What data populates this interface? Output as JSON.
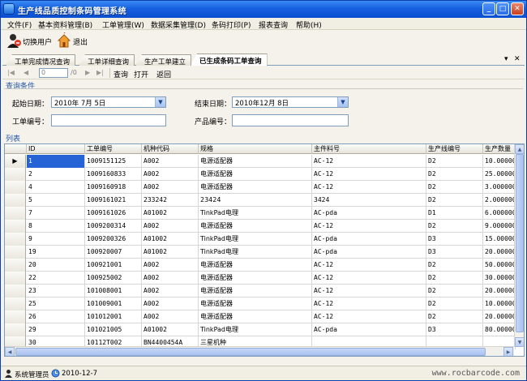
{
  "window": {
    "title": "生产线品质控制条码管理系统"
  },
  "menu": [
    "文件(F)",
    "基本资料管理(B)",
    "工单管理(W)",
    "数据采集管理(D)",
    "条码打印(P)",
    "报表查询",
    "帮助(H)"
  ],
  "toolbar": {
    "switch_user": "切换用户",
    "exit": "退出"
  },
  "tabs": [
    {
      "label": "工单完成情况查询",
      "active": false
    },
    {
      "label": "工单详细查询",
      "active": false
    },
    {
      "label": "生产工单建立",
      "active": false
    },
    {
      "label": "已生成条码工单查询",
      "active": true
    }
  ],
  "nav": {
    "page_value": "0",
    "page_total": "/0",
    "query": "查询",
    "open": "打开",
    "back": "返回"
  },
  "query": {
    "section_title": "查询条件",
    "start_date_label": "起始日期：",
    "start_date_value": "2010年 7月 5日",
    "end_date_label": "结束日期：",
    "end_date_value": "2010年12月 8日",
    "order_no_label": "工单编号：",
    "product_no_label": "产品编号："
  },
  "list": {
    "section_title": "列表",
    "columns": [
      "ID",
      "工单编号",
      "机种代码",
      "规格",
      "主件料号",
      "生产线编号",
      "生产数量"
    ],
    "rows": [
      [
        "1",
        "1009151125",
        "A002",
        "电源适配器",
        "AC-12",
        "D2",
        "10.000000"
      ],
      [
        "2",
        "1009160833",
        "A002",
        "电源适配器",
        "AC-12",
        "D2",
        "25.000000"
      ],
      [
        "4",
        "1009160918",
        "A002",
        "电源适配器",
        "AC-12",
        "D2",
        "3.0000000"
      ],
      [
        "5",
        "1009161021",
        "233242",
        "23424",
        "3424",
        "D2",
        "2.0000000"
      ],
      [
        "7",
        "1009161026",
        "A01002",
        "TinkPad电理",
        "AC-pda",
        "D1",
        "6.0000000"
      ],
      [
        "8",
        "1009200314",
        "A002",
        "电源适配器",
        "AC-12",
        "D2",
        "9.0000000"
      ],
      [
        "9",
        "1009200326",
        "A01002",
        "TinkPad电理",
        "AC-pda",
        "D3",
        "15.000000"
      ],
      [
        "19",
        "100920007",
        "A01002",
        "TinkPad电理",
        "AC-pda",
        "D3",
        "20.000000"
      ],
      [
        "20",
        "100921001",
        "A002",
        "电源适配器",
        "AC-12",
        "D2",
        "50.000000"
      ],
      [
        "22",
        "100925002",
        "A002",
        "电源适配器",
        "AC-12",
        "D2",
        "30.000000"
      ],
      [
        "23",
        "101008001",
        "A002",
        "电源适配器",
        "AC-12",
        "D2",
        "20.000000"
      ],
      [
        "25",
        "101009001",
        "A002",
        "电源适配器",
        "AC-12",
        "D2",
        "10.000000"
      ],
      [
        "26",
        "101012001",
        "A002",
        "电源适配器",
        "AC-12",
        "D2",
        "20.000000"
      ],
      [
        "29",
        "101021005",
        "A01002",
        "TinkPad电理",
        "AC-pda",
        "D3",
        "80.000000"
      ],
      [
        "30",
        "10112T002",
        "BN4400454A",
        "三星机种",
        "",
        "",
        ""
      ]
    ]
  },
  "status": {
    "user": "系统管理员",
    "date": "2010-12-7",
    "watermark": "www.rocbarcode.com"
  }
}
